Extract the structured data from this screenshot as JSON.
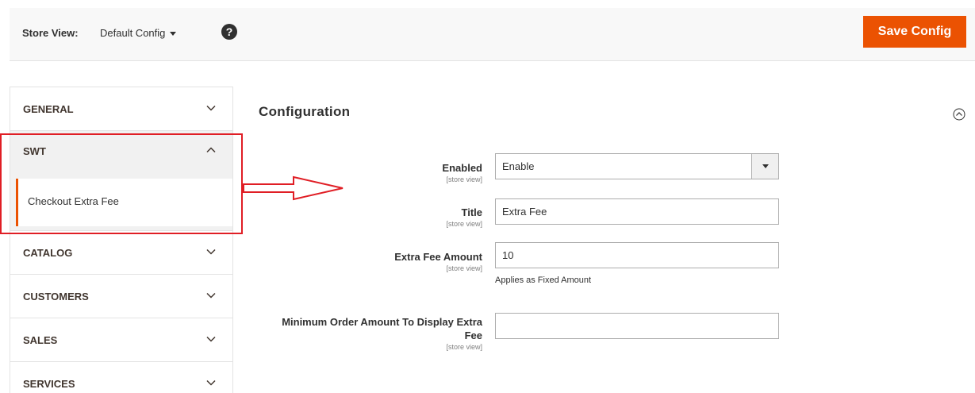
{
  "header": {
    "store_view_label": "Store View:",
    "store_view_value": "Default Config",
    "help_icon": "?",
    "save_label": "Save Config"
  },
  "sidebar": {
    "items": [
      {
        "label": "GENERAL",
        "state": "collapsed"
      },
      {
        "label": "SWT",
        "state": "expanded",
        "children": [
          "Checkout Extra Fee"
        ]
      },
      {
        "label": "CATALOG",
        "state": "collapsed"
      },
      {
        "label": "CUSTOMERS",
        "state": "collapsed"
      },
      {
        "label": "SALES",
        "state": "collapsed"
      },
      {
        "label": "SERVICES",
        "state": "collapsed"
      }
    ]
  },
  "main": {
    "section_title": "Configuration",
    "fields": [
      {
        "label": "Enabled",
        "scope": "[store view]",
        "type": "select",
        "value": "Enable"
      },
      {
        "label": "Title",
        "scope": "[store view]",
        "type": "text",
        "value": "Extra Fee"
      },
      {
        "label": "Extra Fee Amount",
        "scope": "[store view]",
        "type": "text",
        "value": "10",
        "note": "Applies as Fixed Amount"
      },
      {
        "label_line1": "Minimum Order Amount To Display Extra",
        "label_line2": "Fee",
        "scope": "[store view]",
        "type": "text",
        "value": ""
      }
    ]
  },
  "colors": {
    "accent": "#eb5202",
    "highlight": "#e01e25"
  },
  "icons": {
    "chevron": "chevron-down-icon",
    "chevron_open": "chevron-up-icon",
    "collapse": "circle-chevron-up-icon",
    "help": "question-circle-icon"
  }
}
